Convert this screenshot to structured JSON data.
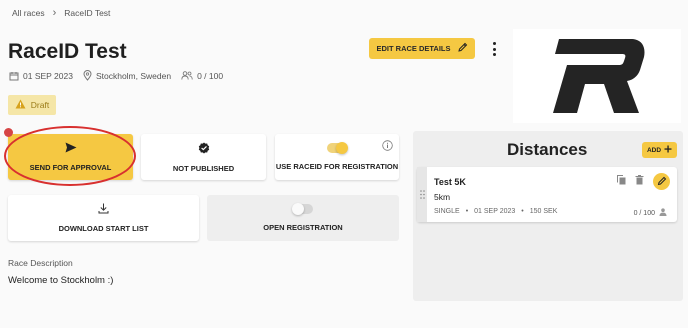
{
  "breadcrumb": {
    "root": "All races",
    "current": "RaceID Test"
  },
  "race": {
    "title": "RaceID Test",
    "date": "01 SEP 2023",
    "location": "Stockholm, Sweden",
    "participants": "0 / 100",
    "status": "Draft"
  },
  "actions": {
    "edit_label": "EDIT RACE DETAILS",
    "send_for_approval": "SEND FOR APPROVAL",
    "not_published": "NOT PUBLISHED",
    "use_raceid": "USE RACEID FOR REGISTRATION",
    "download_start_list": "DOWNLOAD START LIST",
    "open_registration": "OPEN REGISTRATION"
  },
  "description": {
    "label": "Race Description",
    "text": "Welcome to Stockholm :)"
  },
  "distances": {
    "title": "Distances",
    "add_label": "ADD",
    "items": [
      {
        "name": "Test 5K",
        "length": "5km",
        "type": "SINGLE",
        "date": "01 SEP 2023",
        "price": "150 SEK",
        "count": "0 / 100"
      }
    ]
  },
  "colors": {
    "accent": "#f5c842",
    "annotation": "#d8302f",
    "draft_bg": "#f5e6a7"
  },
  "icons": [
    "chevron-right-icon",
    "calendar-icon",
    "location-pin-icon",
    "people-icon",
    "warning-icon",
    "pencil-icon",
    "more-vert-icon",
    "send-icon",
    "verified-icon",
    "info-icon",
    "download-icon",
    "drag-handle-icon",
    "copy-icon",
    "trash-icon",
    "person-icon",
    "plus-icon"
  ]
}
